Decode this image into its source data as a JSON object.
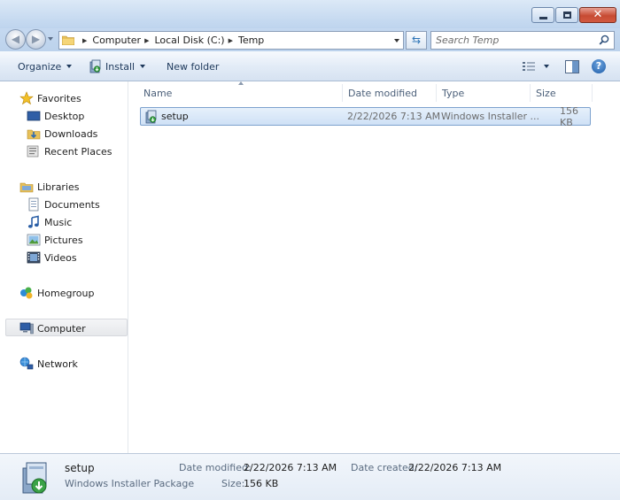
{
  "window": {
    "controls": {
      "minimize": "minimize",
      "maximize": "maximize",
      "close": "✕"
    }
  },
  "address": {
    "crumbs": [
      "Computer",
      "Local Disk (C:)",
      "Temp"
    ],
    "search_placeholder": "Search Temp"
  },
  "toolbar": {
    "organize": "Organize",
    "install": "Install",
    "new_folder": "New folder"
  },
  "sidebar": {
    "favorites": "Favorites",
    "desktop": "Desktop",
    "downloads": "Downloads",
    "recent_places": "Recent Places",
    "libraries": "Libraries",
    "documents": "Documents",
    "music": "Music",
    "pictures": "Pictures",
    "videos": "Videos",
    "homegroup": "Homegroup",
    "computer": "Computer",
    "network": "Network"
  },
  "columns": {
    "name": "Name",
    "date_modified": "Date modified",
    "type": "Type",
    "size": "Size"
  },
  "files": [
    {
      "name": "setup",
      "date_modified": "2/22/2026 7:13 AM",
      "type": "Windows Installer ...",
      "size": "156 KB"
    }
  ],
  "details": {
    "name": "setup",
    "type": "Windows Installer Package",
    "date_modified_label": "Date modified:",
    "date_modified": "2/22/2026 7:13 AM",
    "size_label": "Size:",
    "size": "156 KB",
    "date_created_label": "Date created:",
    "date_created": "2/22/2026 7:13 AM"
  },
  "colors": {
    "title_bar": "#c9dcf1",
    "selection": "#cfe1f6",
    "close_button": "#c74a33"
  }
}
